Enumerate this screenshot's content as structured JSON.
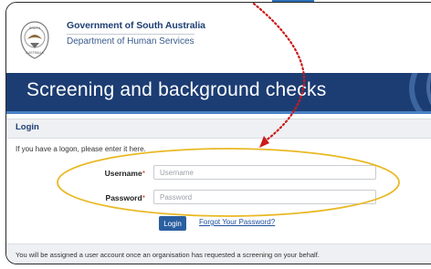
{
  "header": {
    "government_name": "Government of South Australia",
    "department_name": "Department of Human Services",
    "crest_icon": "south-australia-crest-icon"
  },
  "banner": {
    "title": "Screening and background checks",
    "background_color": "#1c3d73",
    "stripe_color": "#4a83c6"
  },
  "login": {
    "heading": "Login",
    "intro": "If you have a logon, please enter it here.",
    "username": {
      "label": "Username",
      "required_marker": "*",
      "placeholder": "Username",
      "value": ""
    },
    "password": {
      "label": "Password",
      "required_marker": "*",
      "placeholder": "Password",
      "value": ""
    },
    "login_button": "Login",
    "forgot_link": "Forgot Your Password?",
    "button_color": "#2a5fa0"
  },
  "footer": {
    "note": "You will be assigned a user account once an organisation has requested a screening on your behalf."
  },
  "annotations": {
    "highlight_color": "#e8b923",
    "arrow_color": "#cc1a1a"
  }
}
